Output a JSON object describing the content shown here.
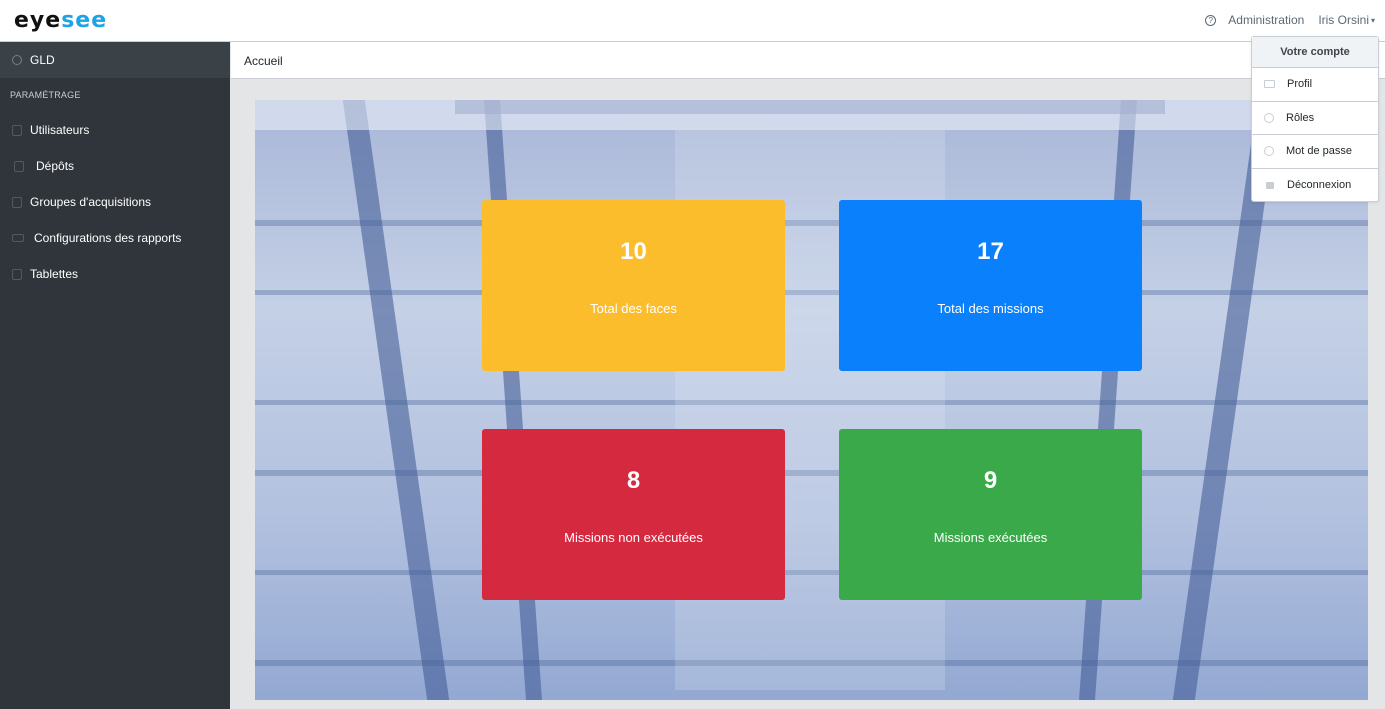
{
  "header": {
    "logo_part1": "eye",
    "logo_part2": "see",
    "help_icon": "help-circle-icon",
    "admin_link": "Administration",
    "user_name": "Iris Orsini",
    "caret": "▾"
  },
  "sidebar": {
    "top_item": "GLD",
    "section_title": "PARAMÉTRAGE",
    "items": [
      {
        "label": "Utilisateurs",
        "icon": "user-icon"
      },
      {
        "label": "Dépôts",
        "icon": "building-icon"
      },
      {
        "label": "Groupes d'acquisitions",
        "icon": "book-icon"
      },
      {
        "label": "Configurations des rapports",
        "icon": "list-icon"
      },
      {
        "label": "Tablettes",
        "icon": "tablet-icon"
      }
    ]
  },
  "breadcrumb": {
    "current": "Accueil"
  },
  "stats": [
    {
      "value": "10",
      "label": "Total des faces",
      "color": "#fbbd2c"
    },
    {
      "value": "17",
      "label": "Total des missions",
      "color": "#0a80fc"
    },
    {
      "value": "8",
      "label": "Missions non exécutées",
      "color": "#d52940"
    },
    {
      "value": "9",
      "label": "Missions exécutées",
      "color": "#3aa94a"
    }
  ],
  "account_menu": {
    "header": "Votre compte",
    "items": [
      {
        "label": "Profil",
        "icon": "id-card-icon"
      },
      {
        "label": "Rôles",
        "icon": "users-icon"
      },
      {
        "label": "Mot de passe",
        "icon": "gear-icon"
      },
      {
        "label": "Déconnexion",
        "icon": "lock-icon"
      }
    ]
  },
  "colors": {
    "sidebar_bg": "#2f353a",
    "accent": "#1ca4e6"
  }
}
